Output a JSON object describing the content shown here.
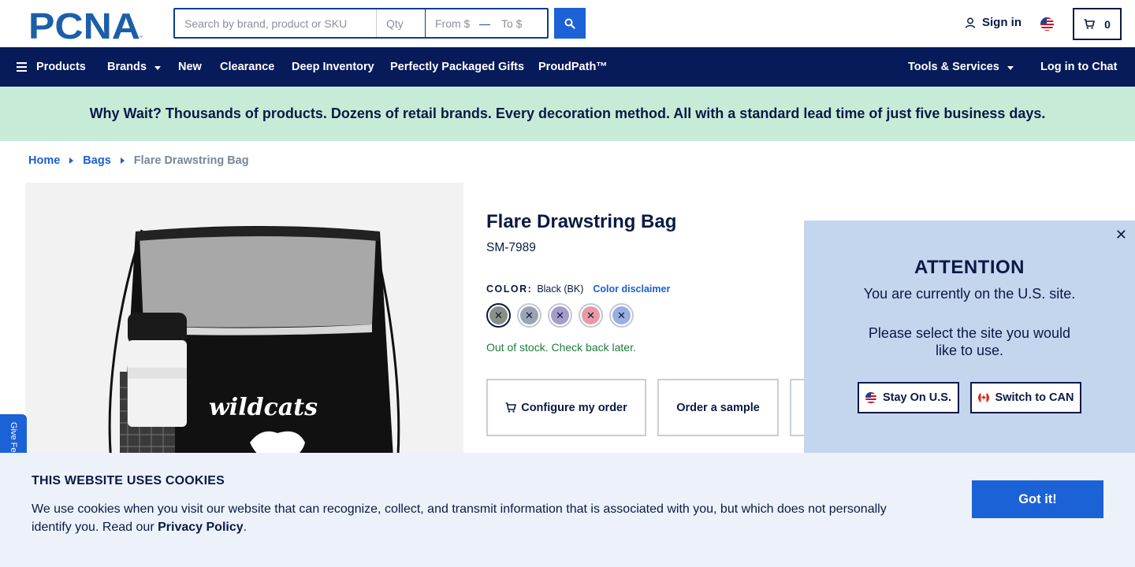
{
  "header": {
    "logo_text": "PCNA",
    "search_placeholder": "Search by brand, product or SKU",
    "qty_placeholder": "Qty",
    "from_placeholder": "From $",
    "range_dash": "—",
    "to_placeholder": "To $",
    "signin_label": "Sign in",
    "cart_count": "0"
  },
  "nav": {
    "products": "Products",
    "brands": "Brands",
    "new": "New",
    "clearance": "Clearance",
    "deep_inventory": "Deep Inventory",
    "gifts": "Perfectly Packaged Gifts",
    "proudpath": "ProudPath™",
    "tools": "Tools & Services",
    "chat": "Log in to Chat"
  },
  "banner": {
    "text": "Why Wait? Thousands of products. Dozens of retail brands. Every decoration method. All with a standard lead time of just five business days."
  },
  "breadcrumb": {
    "home": "Home",
    "bags": "Bags",
    "current": "Flare Drawstring Bag"
  },
  "product": {
    "image_print": "wildcats",
    "title": "Flare Drawstring Bag",
    "sku": "SM-7989",
    "color_label": "COLOR:",
    "color_value": "Black (BK)",
    "color_disclaimer": "Color disclaimer",
    "swatches": [
      {
        "color": "#8a8f86",
        "mark": "✕"
      },
      {
        "color": "#9aa4b4",
        "mark": "✕"
      },
      {
        "color": "#a79bc8",
        "mark": "✕"
      },
      {
        "color": "#e89aa6",
        "mark": "✕"
      },
      {
        "color": "#9aaee0",
        "mark": "✕"
      }
    ],
    "stock_status": "Out of stock. Check back later.",
    "configure_label": "Configure my order",
    "sample_label": "Order a sample"
  },
  "attention": {
    "close": "✕",
    "title": "ATTENTION",
    "line1": "You are currently on the U.S. site.",
    "line2": "Please select the site you would like to use.",
    "stay_label": "Stay On U.S.",
    "switch_label": "Switch to CAN"
  },
  "feedback": {
    "label": "Give Fe"
  },
  "cookie": {
    "title": "THIS WEBSITE USES COOKIES",
    "text": "We use cookies when you visit our website that can recognize, collect, and transmit information that is associated with you, but which does not personally identify you. Read our",
    "link": "Privacy Policy",
    "period": ".",
    "button": "Got it!"
  },
  "colors": {
    "nav_bg": "#071a5a",
    "accent": "#1b62d6",
    "banner_bg": "#c6ecd8",
    "modal_bg": "#c4d5ee",
    "stock_green": "#1e7a3b"
  }
}
